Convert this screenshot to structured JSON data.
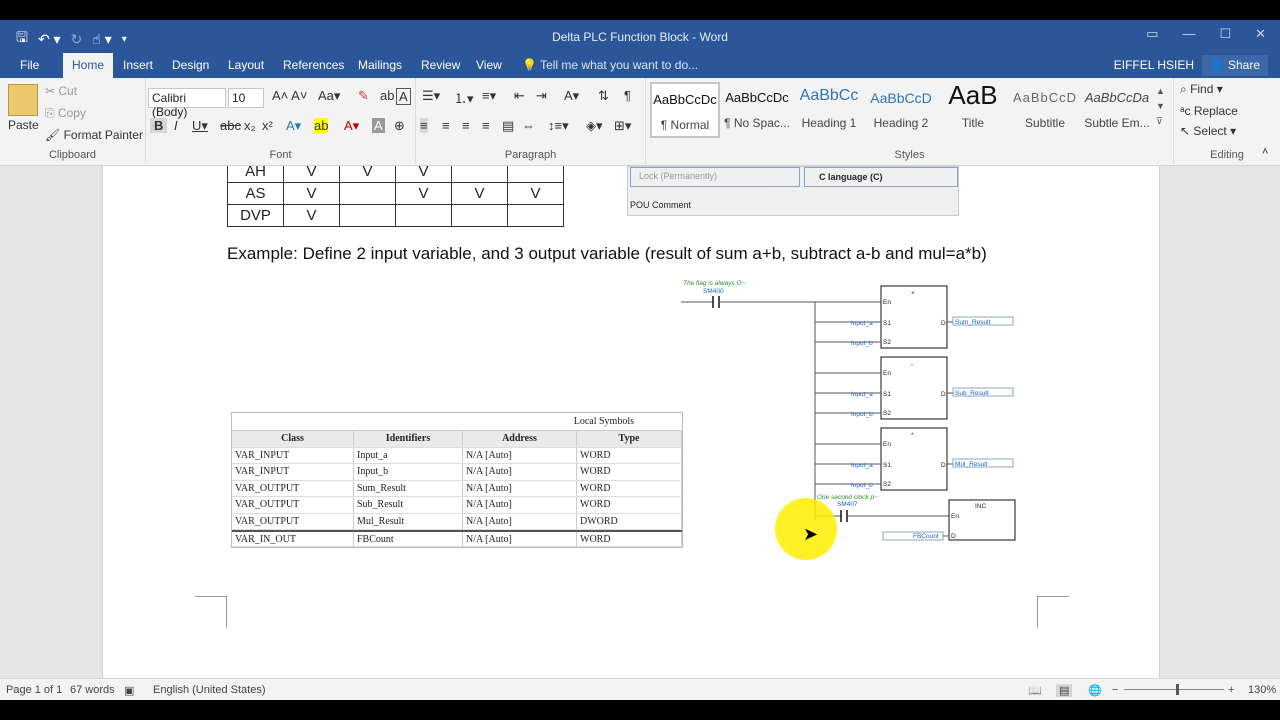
{
  "window": {
    "title": "Delta PLC Function Block - Word",
    "controls": [
      "—",
      "☐",
      "✕"
    ]
  },
  "qat": {
    "save_icon": "save-icon",
    "undo_icon": "undo-icon",
    "redo_icon": "redo-icon",
    "touch_icon": "touch-mode-icon"
  },
  "tabs": [
    {
      "label": "File"
    },
    {
      "label": "Home"
    },
    {
      "label": "Insert"
    },
    {
      "label": "Design"
    },
    {
      "label": "Layout"
    },
    {
      "label": "References"
    },
    {
      "label": "Mailings"
    },
    {
      "label": "Review"
    },
    {
      "label": "View"
    }
  ],
  "tellme": "Tell me what you want to do...",
  "user": "EIFFEL HSIEH",
  "share": "Share",
  "clipboard": {
    "paste": "Paste",
    "cut": "Cut",
    "copy": "Copy",
    "format_painter": "Format Painter",
    "label": "Clipboard"
  },
  "font": {
    "name": "Calibri (Body)",
    "size": "10",
    "label": "Font"
  },
  "paragraph": {
    "label": "Paragraph"
  },
  "styles": {
    "label": "Styles",
    "items": [
      {
        "preview": "AaBbCcDc",
        "name": "¶ Normal"
      },
      {
        "preview": "AaBbCcDc",
        "name": "¶ No Spac..."
      },
      {
        "preview": "AaBbCc",
        "name": "Heading 1"
      },
      {
        "preview": "AaBbCcD",
        "name": "Heading 2"
      },
      {
        "preview": "AaB",
        "name": "Title"
      },
      {
        "preview": "AaBbCcD",
        "name": "Subtitle"
      },
      {
        "preview": "AaBbCcDa",
        "name": "Subtle Em..."
      }
    ]
  },
  "editing": {
    "find": "Find",
    "replace": "Replace",
    "select": "Select",
    "label": "Editing"
  },
  "doc": {
    "top_table": [
      [
        "AH",
        "V",
        "V",
        "V",
        "",
        ""
      ],
      [
        "AS",
        "V",
        "",
        "V",
        "V",
        "V"
      ],
      [
        "DVP",
        "V",
        "",
        "",
        "",
        ""
      ]
    ],
    "dialog": {
      "lock": "Lock (Permanently)",
      "c_lang": "C language (C)",
      "pou_comment": "POU Comment"
    },
    "example": "Example: Define 2 input variable, and 3 output variable (result of sum a+b, subtract a-b and mul=a*b)",
    "symbols": {
      "title": "Local Symbols",
      "headers": [
        "Class",
        "Identifiers",
        "Address",
        "Type"
      ],
      "rows": [
        [
          "VAR_INPUT",
          "Input_a",
          "N/A [Auto]",
          "WORD"
        ],
        [
          "VAR_INPUT",
          "Input_b",
          "N/A [Auto]",
          "WORD"
        ],
        [
          "VAR_OUTPUT",
          "Sum_Result",
          "N/A [Auto]",
          "WORD"
        ],
        [
          "VAR_OUTPUT",
          "Sub_Result",
          "N/A [Auto]",
          "WORD"
        ],
        [
          "VAR_OUTPUT",
          "Mul_Result",
          "N/A [Auto]",
          "DWORD"
        ],
        [
          "VAR_IN_OUT",
          "FBCount",
          "N/A [Auto]",
          "WORD"
        ]
      ]
    },
    "ladder": {
      "comment1": "The flag is always O~",
      "contact1": "SM400",
      "comment2": "One second clock p~",
      "contact2": "SM407",
      "blocks": [
        {
          "op": "+",
          "out": "Sum_Result"
        },
        {
          "op": "-",
          "out": "Sub_Result"
        },
        {
          "op": "*",
          "out": "Mul_Result"
        }
      ],
      "inc": "INC",
      "fbcount": "FBCount",
      "input_a": "Input_a",
      "input_b": "Input_b",
      "pin_en": "En",
      "pin_s1": "S1",
      "pin_s2": "S2",
      "pin_d": "D"
    }
  },
  "status": {
    "page": "Page 1 of 1",
    "words": "67 words",
    "language": "English (United States)",
    "zoom": "130%"
  }
}
